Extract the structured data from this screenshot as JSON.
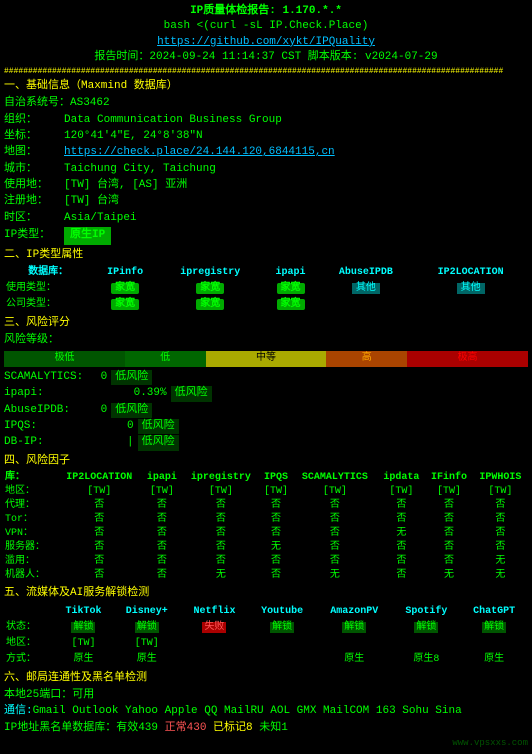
{
  "header": {
    "title": "IP质量体检报告: 1.170.*.*",
    "subtitle": "bash <(curl -sL IP.Check.Place)",
    "github_link": "https://github.com/xykt/IPQuality",
    "report_time": "报告时间：2024-09-24 11:14:37 CST  脚本版本: v2024-07-29",
    "divider": "########################################################################################################"
  },
  "basic_info": {
    "section": "一、基础信息（Maxmind 数据库）",
    "fields": [
      {
        "label": "自治系统号：",
        "value": "AS3462"
      },
      {
        "label": "组织：",
        "value": "Data Communication Business Group"
      },
      {
        "label": "坐标：",
        "value": "120°41'4\"E, 24°8'38\"N"
      },
      {
        "label": "地图：",
        "value": "https://check.place/24.144.120.6844.15.cn",
        "type": "link"
      },
      {
        "label": "城市：",
        "value": "Taichung City, Taichung"
      },
      {
        "label": "使用地：",
        "value": "[TW] 台湾, [AS] 亚洲"
      },
      {
        "label": "注册地：",
        "value": "[TW] 台湾"
      },
      {
        "label": "时区：",
        "value": "Asia/Taipei"
      },
      {
        "label": "IP类型：",
        "value": "原生IP",
        "type": "badge-green"
      }
    ]
  },
  "ip_type": {
    "section": "二、IP类型属性",
    "headers": [
      "数据库：",
      "IPinfo",
      "ipregistry",
      "ipapi",
      "AbuseIPDB",
      "IP2LOCATION"
    ],
    "rows": [
      {
        "label": "使用类型：",
        "values": [
          "家宽",
          "家宽",
          "家宽",
          "其他",
          "其他"
        ]
      },
      {
        "label": "公司类型：",
        "values": [
          "家宽",
          "家宽",
          "家宽",
          "",
          ""
        ]
      }
    ]
  },
  "risk": {
    "section": "三、风险评分",
    "bar_labels": [
      "极低",
      "低",
      "中等",
      "高",
      "极高"
    ],
    "items": [
      {
        "label": "SCAMALYTICS:",
        "score": "0",
        "text": "低风险"
      },
      {
        "label": "ipapi:",
        "score": "0.39%",
        "text": "低风险"
      },
      {
        "label": "AbuseIPDB:",
        "score": "0",
        "text": "低风险"
      },
      {
        "label": "IPQS:",
        "score": "0",
        "text": "低风险"
      },
      {
        "label": "DB-IP:",
        "score": "|",
        "text": "低风险"
      }
    ]
  },
  "risk_factors": {
    "section": "四、风险因子",
    "headers": [
      "库：",
      "IP2LOCATION",
      "ipapi",
      "ipregistry",
      "IPQS",
      "SCAMALYTICS",
      "ipdata",
      "IFinfo",
      "IPWHOIS"
    ],
    "rows": [
      {
        "label": "地区：",
        "values": [
          "[TW]",
          "[TW]",
          "[TW]",
          "[TW]",
          "[TW]",
          "[TW]",
          "[TW]",
          "[TW]"
        ]
      },
      {
        "label": "代理：",
        "values": [
          "否",
          "否",
          "否",
          "否",
          "否",
          "否",
          "否",
          "否"
        ]
      },
      {
        "label": "Tor：",
        "values": [
          "否",
          "否",
          "否",
          "否",
          "否",
          "否",
          "否",
          "否"
        ]
      },
      {
        "label": "VPN：",
        "values": [
          "否",
          "否",
          "否",
          "否",
          "否",
          "无",
          "否",
          "否"
        ]
      },
      {
        "label": "服务器：",
        "values": [
          "否",
          "否",
          "否",
          "无",
          "否",
          "否",
          "否",
          "否"
        ]
      },
      {
        "label": "滥用：",
        "values": [
          "否",
          "否",
          "否",
          "否",
          "否",
          "否",
          "否",
          "无"
        ]
      },
      {
        "label": "机器人：",
        "values": [
          "否",
          "否",
          "无",
          "否",
          "无",
          "否",
          "无",
          "无"
        ]
      }
    ]
  },
  "media": {
    "section": "五、流媒体及AI服务解锁检测",
    "headers": [
      "TikTok",
      "Disney+",
      "Netflix",
      "Youtube",
      "AmazonPV",
      "Spotify",
      "ChatGPT"
    ],
    "status_row": {
      "label": "状态：",
      "values": [
        "解锁",
        "解锁",
        "失败",
        "解锁",
        "解锁",
        "解锁",
        "解锁"
      ],
      "types": [
        "unlocked",
        "unlocked",
        "failed",
        "unlocked",
        "unlocked",
        "unlocked",
        "unlocked"
      ]
    },
    "region_row": {
      "label": "地区：",
      "values": [
        "[TW]",
        "[TW]",
        "",
        "",
        "",
        "",
        ""
      ]
    },
    "method_row": {
      "label": "方式：",
      "values": [
        "原生",
        "原生",
        "",
        "",
        "原生",
        "原生8",
        "原生",
        "原生"
      ]
    }
  },
  "email": {
    "section": "六、邮局连通性及黑名单检测",
    "providers": "Gmail  Outlook  Yahoo  Apple  QQ  MailRU  AOL  GMX  MailCOM  163  Sohu  Sina",
    "ip_databases": {
      "label": "IP地址黑名单数据库：",
      "valid": {
        "label": "有效",
        "count": "439"
      },
      "error": {
        "label": "正常",
        "count": "430"
      },
      "marked": {
        "label": "已标记",
        "count": "8"
      },
      "unknown": {
        "label": "未知",
        "count": "1"
      }
    },
    "local25": "本地25端口：可用"
  },
  "watermark": "www.vpsxxs.com"
}
